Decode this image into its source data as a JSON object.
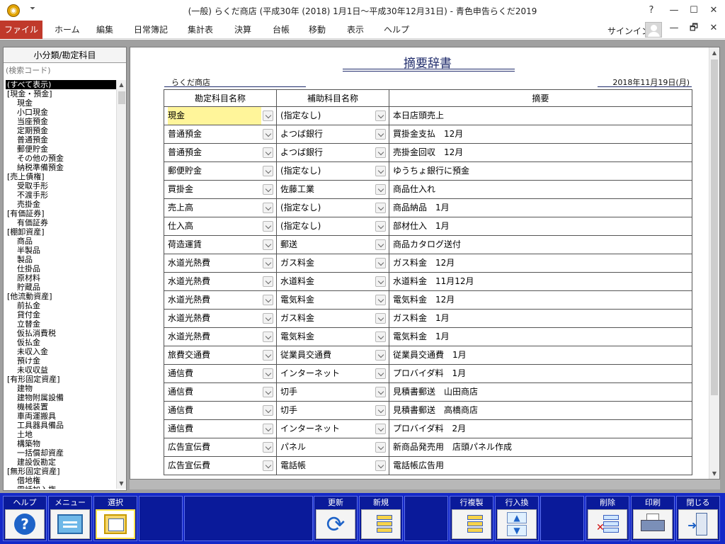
{
  "window": {
    "title": "(一般) らくだ商店 (平成30年 (2018) 1月1日～平成30年12月31日) - 青色申告らくだ2019",
    "help": "?",
    "minimize": "—",
    "maximize": "☐",
    "close": "✕"
  },
  "ribbon": {
    "file": "ファイル",
    "tabs": [
      "ホーム",
      "編集",
      "日常簿記",
      "集計表",
      "決算",
      "台帳",
      "移動",
      "表示",
      "ヘルプ"
    ],
    "signin": "サインイン",
    "min": "—",
    "restore": "🗗",
    "close": "✕"
  },
  "left_panel": {
    "header": "小分類/勘定科目",
    "search_placeholder": "(検索コード)",
    "items": [
      {
        "label": "(すべて表示)",
        "type": "cat",
        "selected": true
      },
      {
        "label": "[現金・預金]",
        "type": "cat"
      },
      {
        "label": "現金",
        "type": "sub"
      },
      {
        "label": "小口現金",
        "type": "sub"
      },
      {
        "label": "当座預金",
        "type": "sub"
      },
      {
        "label": "定期預金",
        "type": "sub"
      },
      {
        "label": "普通預金",
        "type": "sub"
      },
      {
        "label": "郵便貯金",
        "type": "sub"
      },
      {
        "label": "その他の預金",
        "type": "sub"
      },
      {
        "label": "納税準備預金",
        "type": "sub"
      },
      {
        "label": "[売上債権]",
        "type": "cat"
      },
      {
        "label": "受取手形",
        "type": "sub"
      },
      {
        "label": "不渡手形",
        "type": "sub"
      },
      {
        "label": "売掛金",
        "type": "sub"
      },
      {
        "label": "[有価証券]",
        "type": "cat"
      },
      {
        "label": "有価証券",
        "type": "sub"
      },
      {
        "label": "[棚卸資産]",
        "type": "cat"
      },
      {
        "label": "商品",
        "type": "sub"
      },
      {
        "label": "半製品",
        "type": "sub"
      },
      {
        "label": "製品",
        "type": "sub"
      },
      {
        "label": "仕掛品",
        "type": "sub"
      },
      {
        "label": "原材料",
        "type": "sub"
      },
      {
        "label": "貯蔵品",
        "type": "sub"
      },
      {
        "label": "[他流動資産]",
        "type": "cat"
      },
      {
        "label": "前払金",
        "type": "sub"
      },
      {
        "label": "貸付金",
        "type": "sub"
      },
      {
        "label": "立替金",
        "type": "sub"
      },
      {
        "label": "仮払消費税",
        "type": "sub"
      },
      {
        "label": "仮払金",
        "type": "sub"
      },
      {
        "label": "未収入金",
        "type": "sub"
      },
      {
        "label": "預け金",
        "type": "sub"
      },
      {
        "label": "未収収益",
        "type": "sub"
      },
      {
        "label": "[有形固定資産]",
        "type": "cat"
      },
      {
        "label": "建物",
        "type": "sub"
      },
      {
        "label": "建物附属設備",
        "type": "sub"
      },
      {
        "label": "機械装置",
        "type": "sub"
      },
      {
        "label": "車両運搬具",
        "type": "sub"
      },
      {
        "label": "工具器具備品",
        "type": "sub"
      },
      {
        "label": "土地",
        "type": "sub"
      },
      {
        "label": "構築物",
        "type": "sub"
      },
      {
        "label": "一括償却資産",
        "type": "sub"
      },
      {
        "label": "建設仮勘定",
        "type": "sub"
      },
      {
        "label": "[無形固定資産]",
        "type": "cat"
      },
      {
        "label": "借地権",
        "type": "sub"
      },
      {
        "label": "電話加入権",
        "type": "sub"
      }
    ]
  },
  "document": {
    "title": "摘要辞書",
    "company": "らくだ商店",
    "date": "2018年11月19日(月)",
    "columns": [
      "勘定科目名称",
      "補助科目名称",
      "摘要"
    ],
    "rows": [
      {
        "account": "現金",
        "sub": "(指定なし)",
        "memo": "本日店頭売上"
      },
      {
        "account": "普通預金",
        "sub": "よつば銀行",
        "memo": "買掛金支払　12月"
      },
      {
        "account": "普通預金",
        "sub": "よつば銀行",
        "memo": "売掛金回収　12月"
      },
      {
        "account": "郵便貯金",
        "sub": "(指定なし)",
        "memo": "ゆうちょ銀行に預金"
      },
      {
        "account": "買掛金",
        "sub": "佐藤工業",
        "memo": "商品仕入れ"
      },
      {
        "account": "売上高",
        "sub": "(指定なし)",
        "memo": "商品納品　1月"
      },
      {
        "account": "仕入高",
        "sub": "(指定なし)",
        "memo": "部材仕入　1月"
      },
      {
        "account": "荷造運賃",
        "sub": "郵送",
        "memo": "商品カタログ送付"
      },
      {
        "account": "水道光熱費",
        "sub": "ガス料金",
        "memo": "ガス料金　12月"
      },
      {
        "account": "水道光熱費",
        "sub": "水道料金",
        "memo": "水道料金　11月12月"
      },
      {
        "account": "水道光熱費",
        "sub": "電気料金",
        "memo": "電気料金　12月"
      },
      {
        "account": "水道光熱費",
        "sub": "ガス料金",
        "memo": "ガス料金　1月"
      },
      {
        "account": "水道光熱費",
        "sub": "電気料金",
        "memo": "電気料金　1月"
      },
      {
        "account": "旅費交通費",
        "sub": "従業員交通費",
        "memo": "従業員交通費　1月"
      },
      {
        "account": "通信費",
        "sub": "インターネット",
        "memo": "プロバイダ料　1月"
      },
      {
        "account": "通信費",
        "sub": "切手",
        "memo": "見積書郵送　山田商店"
      },
      {
        "account": "通信費",
        "sub": "切手",
        "memo": "見積書郵送　高橋商店"
      },
      {
        "account": "通信費",
        "sub": "インターネット",
        "memo": "プロバイダ料　2月"
      },
      {
        "account": "広告宣伝費",
        "sub": "パネル",
        "memo": "新商品発売用　店頭パネル作成"
      },
      {
        "account": "広告宣伝費",
        "sub": "電話帳",
        "memo": "電話帳広告用"
      }
    ]
  },
  "function_keys": {
    "help": "ヘルプ",
    "menu": "メニュー",
    "select": "選択",
    "refresh": "更新",
    "new": "新規",
    "copy_row": "行複製",
    "insert_row": "行入換",
    "delete": "削除",
    "print": "印刷",
    "close": "閉じる"
  },
  "icons": [
    "app-icon",
    "help-icon",
    "menu-icon",
    "select-icon",
    "refresh-icon",
    "new-icon",
    "copy-row-icon",
    "insert-row-icon",
    "delete-icon",
    "print-icon",
    "close-icon",
    "chevron-down-icon"
  ],
  "colors": {
    "file_tab": "#c0392b",
    "function_bar": "#1428c8",
    "title_text": "#1f2b6b",
    "highlight": "#fff59a"
  }
}
